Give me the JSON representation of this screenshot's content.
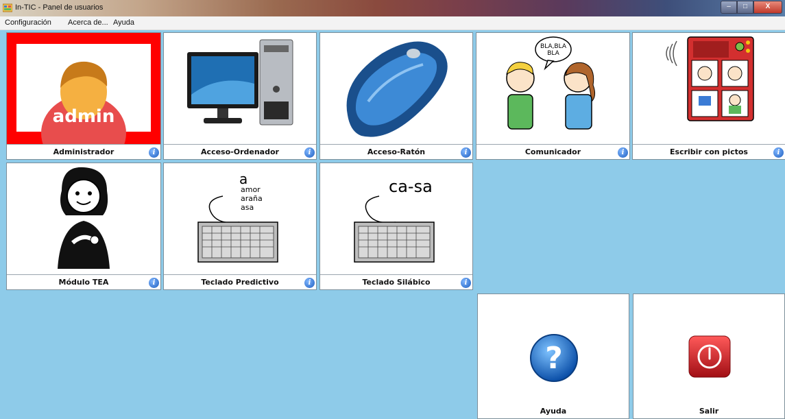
{
  "window": {
    "title": "In-TIC - Panel de usuarios",
    "minimize": "–",
    "maximize": "□",
    "close": "X"
  },
  "menu": [
    "Configuración",
    "Acerca de...",
    "Ayuda"
  ],
  "tiles": [
    {
      "label": "Administrador",
      "icon": "admin-user-icon",
      "picture_text": "admin"
    },
    {
      "label": "Acceso-Ordenador",
      "icon": "computer-icon"
    },
    {
      "label": "Acceso-Ratón",
      "icon": "mouse-icon"
    },
    {
      "label": "Comunicador",
      "icon": "conversation-icon",
      "picture_text": "BLA,BLA\nBLA"
    },
    {
      "label": "Escribir con pictos",
      "icon": "picto-board-icon"
    },
    {
      "label": "Módulo TEA",
      "icon": "child-pointing-icon"
    },
    {
      "label": "Teclado Predictivo",
      "icon": "keyboard-icon",
      "picture_text": {
        "letter": "a",
        "words": [
          "amor",
          "araña",
          "asa"
        ]
      }
    },
    {
      "label": "Teclado Silábico",
      "icon": "keyboard-icon",
      "picture_text": "ca-sa"
    }
  ],
  "actions": [
    {
      "label": "Ayuda",
      "icon": "help-icon"
    },
    {
      "label": "Salir",
      "icon": "power-icon"
    }
  ],
  "info_glyph": "i",
  "help_glyph": "?",
  "colors": {
    "background": "#8ecbe9",
    "admin_border": "#ff0000",
    "info": "#1f5fbf",
    "exit": "#c8161d"
  }
}
